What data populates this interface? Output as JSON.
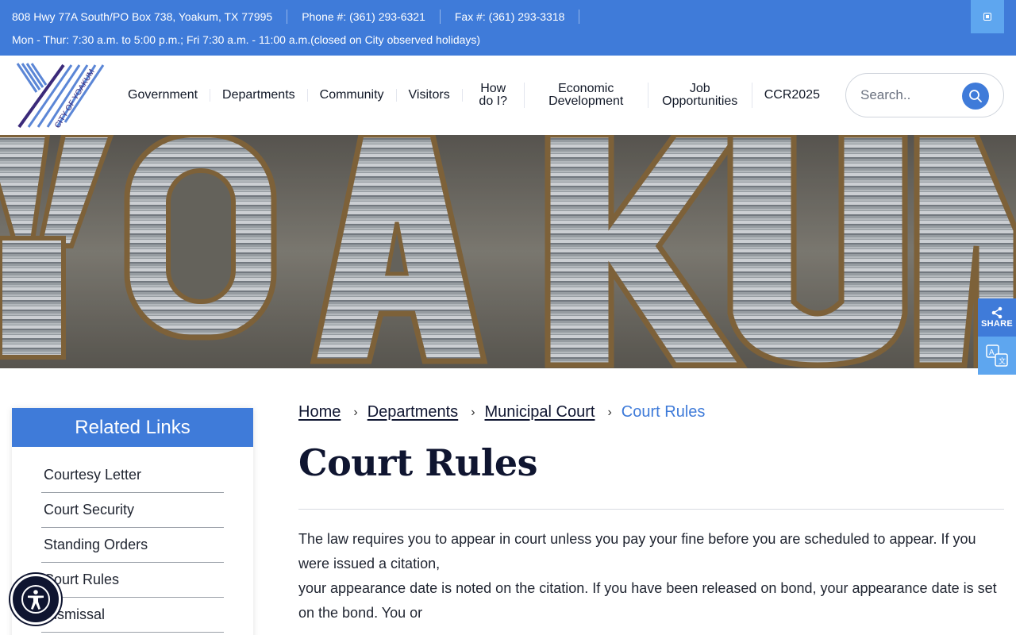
{
  "topbar": {
    "address": "808 Hwy 77A South/PO Box 738, Yoakum, TX 77995",
    "phone": "Phone #: (361) 293-6321",
    "fax": "Fax #: (361) 293-3318",
    "hours": "Mon - Thur:  7:30 a.m. to 5:00 p.m.; Fri 7:30 a.m. - 11:00 a.m.(closed on City observed holidays)"
  },
  "logo": {
    "text": "CITY OF YOAKUM"
  },
  "nav": [
    {
      "label": "Government"
    },
    {
      "label": "Departments"
    },
    {
      "label": "Community"
    },
    {
      "label": "Visitors"
    },
    {
      "label": "How\ndo I?"
    },
    {
      "label": "Economic\nDevelopment"
    },
    {
      "label": "Job\nOpportunities"
    },
    {
      "label": "CCR2025"
    }
  ],
  "search": {
    "placeholder": "Search.."
  },
  "share": {
    "label": "SHARE"
  },
  "sidebar": {
    "title": "Related Links",
    "items": [
      {
        "label": "Courtesy Letter"
      },
      {
        "label": "Court Security"
      },
      {
        "label": "Standing Orders"
      },
      {
        "label": "Court Rules"
      },
      {
        "label": "Dismissal"
      }
    ]
  },
  "breadcrumb": {
    "home": "Home",
    "departments": "Departments",
    "municipal_court": "Municipal Court",
    "current": "Court Rules"
  },
  "page": {
    "title": "Court Rules",
    "para1": "The law requires you to appear in court unless you pay your fine before you are scheduled to appear.  If you were issued a citation,",
    "para2": "your appearance date is noted on the citation.  If you have been released on bond, your appearance date is set on the bond.  You or"
  },
  "colors": {
    "accent": "#3f7bd9",
    "light_accent": "#5ea6ef",
    "navy": "#0f1530"
  }
}
